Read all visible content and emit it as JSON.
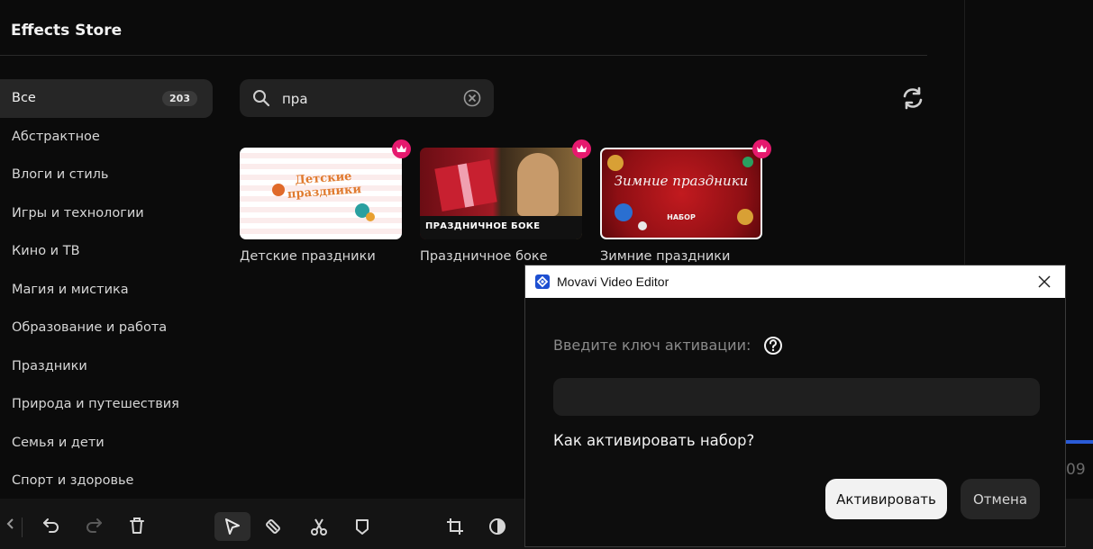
{
  "store": {
    "title": "Effects Store",
    "categories": [
      {
        "label": "Все",
        "count": "203"
      },
      {
        "label": "Абстрактное"
      },
      {
        "label": "Влоги и стиль"
      },
      {
        "label": "Игры и технологии"
      },
      {
        "label": "Кино и ТВ"
      },
      {
        "label": "Магия и мистика"
      },
      {
        "label": "Образование и работа"
      },
      {
        "label": "Праздники"
      },
      {
        "label": "Природа и путешествия"
      },
      {
        "label": "Семья и дети"
      },
      {
        "label": "Спорт и здоровье"
      }
    ],
    "search": {
      "value": "пра"
    },
    "cards": [
      {
        "label": "Детские праздники",
        "thumb_text": "Детские праздники",
        "premium": true
      },
      {
        "label": "Праздничное боке",
        "thumb_text": "ПРАЗДНИЧНОЕ БОКЕ",
        "premium": true
      },
      {
        "label": "Зимние праздники",
        "thumb_text": "Зимние праздники",
        "thumb_sub": "НАБОР",
        "premium": true
      }
    ]
  },
  "right": {
    "partial_number": "09"
  },
  "dialog": {
    "title": "Movavi Video Editor",
    "prompt": "Введите ключ активации:",
    "key_value": "",
    "how_to_link": "Как активировать набор?",
    "activate_label": "Активировать",
    "cancel_label": "Отмена"
  },
  "colors": {
    "accent_premium": "#e6196e",
    "brand_blue": "#1d4fd1",
    "background": "#0b0b0b"
  }
}
